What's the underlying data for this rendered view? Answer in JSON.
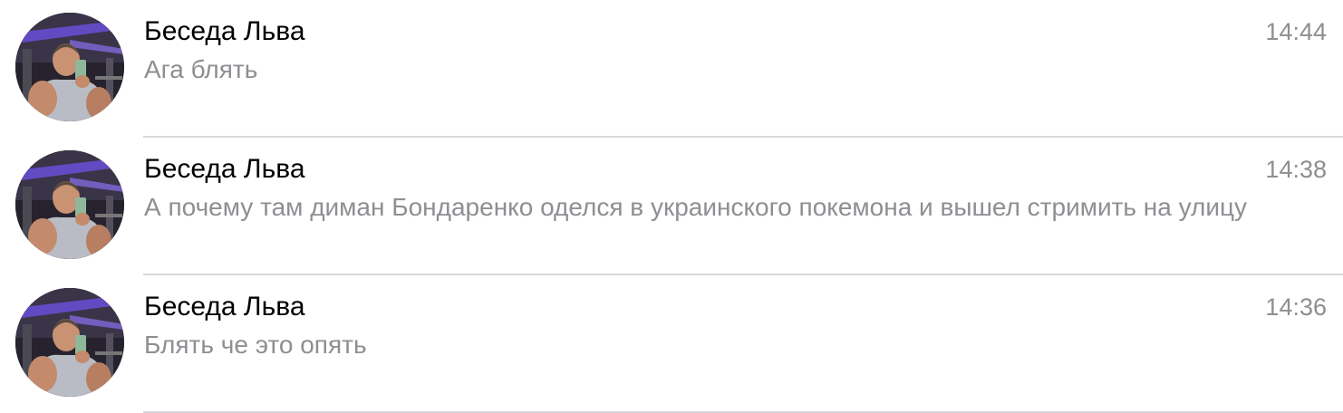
{
  "chats": [
    {
      "title": "Беседа Льва",
      "time": "14:44",
      "preview": "Ага блять",
      "avatar_icon": "user-photo-gym-selfie"
    },
    {
      "title": "Беседа Льва",
      "time": "14:38",
      "preview": "А почему там диман Бондаренко оделся в украинского покемона и вышел стримить на улицу",
      "avatar_icon": "user-photo-gym-selfie"
    },
    {
      "title": "Беседа Льва",
      "time": "14:36",
      "preview": "Блять че это опять",
      "avatar_icon": "user-photo-gym-selfie"
    }
  ],
  "colors": {
    "title": "#000000",
    "secondary_text": "#8e8e93",
    "separator": "#d8d8dc",
    "background": "#ffffff",
    "gym_accent": "#6a4fd8"
  }
}
